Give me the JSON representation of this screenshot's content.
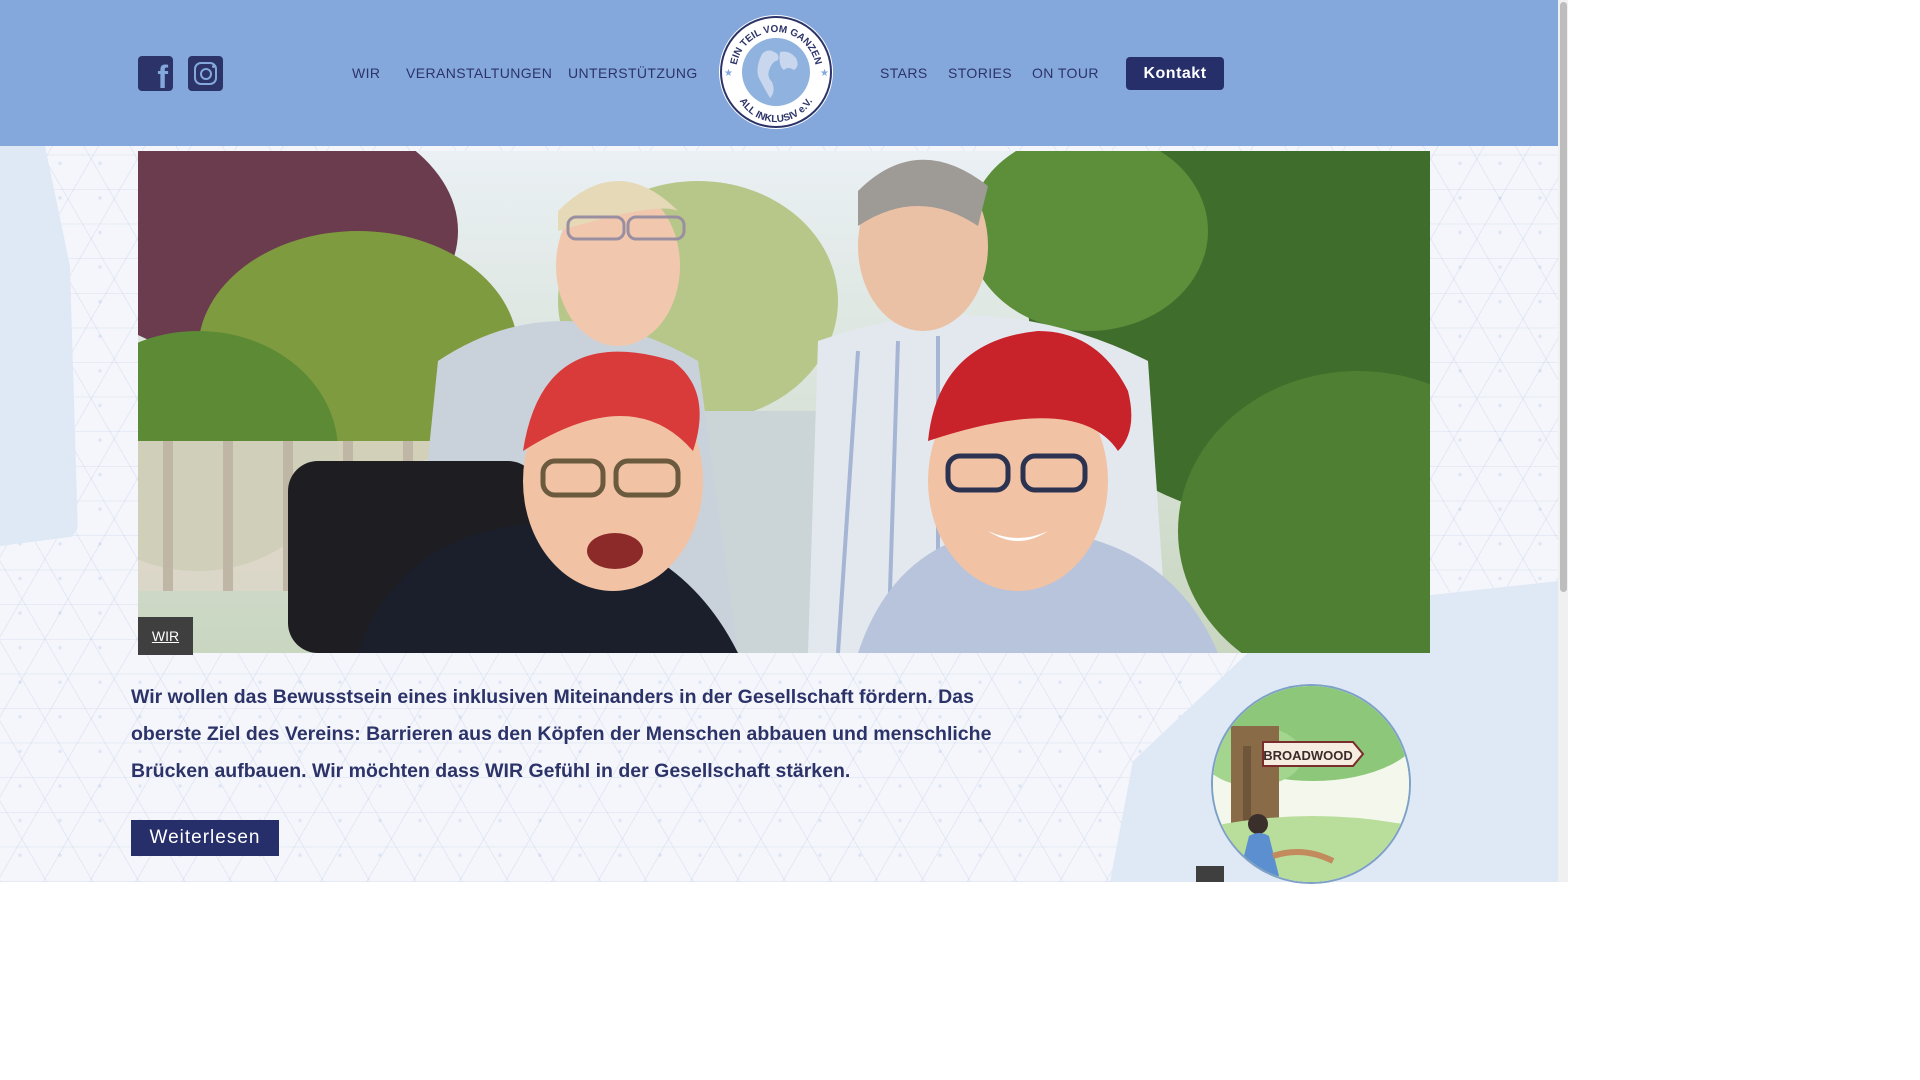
{
  "header": {
    "nav_left": [
      "WIR",
      "VERANSTALTUNGEN",
      "UNTERSTÜTZUNG"
    ],
    "nav_right": [
      "STARS",
      "STORIES",
      "ON TOUR"
    ],
    "contact_label": "Kontakt",
    "logo": {
      "top_text": "EIN TEIL VOM GANZEN",
      "bottom_text": "ALL INKLUSIV e.V."
    },
    "social": [
      "facebook-icon",
      "instagram-icon"
    ]
  },
  "hero": {
    "caption": "WIR"
  },
  "intro": {
    "text": "Wir wollen das Bewusstsein eines inklusiven Miteinanders in der Gesellschaft fördern. Das oberste Ziel des Vereins: Barrieren aus den Köpfen der Menschen abbauen und menschliche Brücken aufbauen. Wir möchten dass WIR Gefühl in der Gesellschaft stärken.",
    "button_label": "Weiterlesen"
  },
  "book": {
    "sign_text": "BROADWOOD"
  },
  "colors": {
    "header_bg": "#84a8dc",
    "navy": "#2c3369",
    "button_bg": "#272f6a"
  }
}
